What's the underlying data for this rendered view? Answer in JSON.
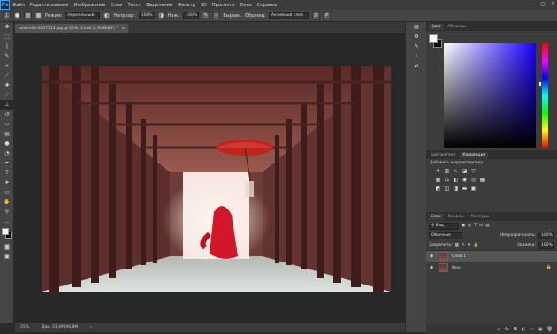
{
  "app": {
    "logo": "Ps"
  },
  "menu": [
    "Файл",
    "Редактирование",
    "Изображение",
    "Слои",
    "Текст",
    "Выделение",
    "Фильтр",
    "3D",
    "Просмотр",
    "Окно",
    "Справка"
  ],
  "window_controls": [
    "–",
    "▢",
    "✕"
  ],
  "options": {
    "mode_label": "Режим:",
    "mode_value": "Нормальный",
    "opacity_label": "Непрозр.:",
    "opacity_value": "100%",
    "flow_label": "Наж.:",
    "flow_value": "100%",
    "aligned_label": "Выравн.",
    "sample_label": "Образец:",
    "sample_value": "Активный слой"
  },
  "document": {
    "tab_title": "umbrella-1807513.jpg @ 25% (Слой 1, RGB/8#) *",
    "tab_close": "×",
    "zoom": "25%",
    "doc_size": "Док: 23,4M/46,8M"
  },
  "color_panel": {
    "tabs": [
      "Цвет",
      "Образцы"
    ]
  },
  "adjust_panel": {
    "tabs": [
      "Библиотеки",
      "Коррекция"
    ],
    "title": "Добавить корректировку"
  },
  "layers_panel": {
    "tabs": [
      "Слои",
      "Каналы",
      "Контуры"
    ],
    "filter_label": "Вид",
    "blend_mode": "Обычные",
    "opacity_label": "Непрозрачность:",
    "opacity_value": "100%",
    "lock_label": "Закрепить:",
    "fill_label": "Заливка:",
    "fill_value": "100%",
    "layers": [
      {
        "name": "Слой 1",
        "selected": true
      },
      {
        "name": "Фон",
        "selected": false,
        "locked": true
      }
    ]
  },
  "colors": {
    "accent": "#31a8ff",
    "panel": "#3c3c3c",
    "canvas_bg": "#282828"
  }
}
